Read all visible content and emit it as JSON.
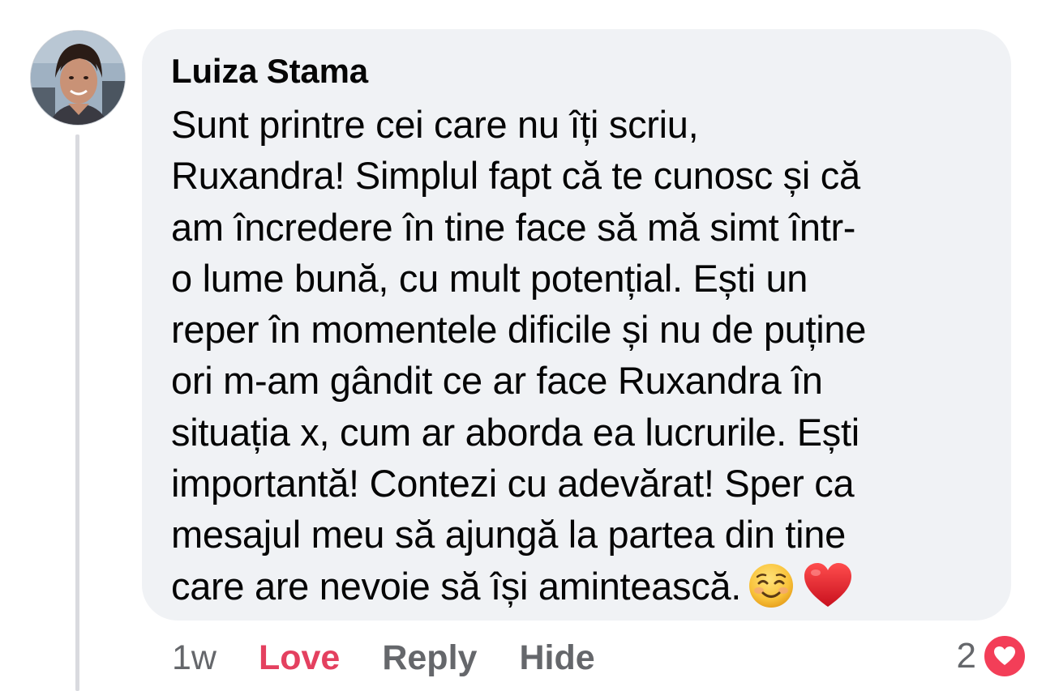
{
  "comment": {
    "author": "Luiza Stama",
    "text": "Sunt printre cei care nu îți scriu,\nRuxandra! Simplul fapt că te cunosc și că\nam încredere în tine face să mă simt într-\no lume bună, cu mult potențial. Ești un\nreper în momentele dificile și nu de puține\nori m-am gândit ce ar face Ruxandra în\nsituația x, cum ar aborda ea lucrurile. Ești\nimportantă! Contezi cu adevărat! Sper ca\nmesajul meu să ajungă la partea din tine\ncare are nevoie să își amintească.",
    "emojis": [
      "smiling-face-emoji",
      "red-heart-emoji"
    ]
  },
  "actions": {
    "time": "1w",
    "love": "Love",
    "reply": "Reply",
    "hide": "Hide"
  },
  "reactions": {
    "count": "2",
    "type": "love-reaction-icon"
  },
  "colors": {
    "bubble": "#f0f2f5",
    "love_active": "#e4405f",
    "secondary_text": "#65676b",
    "love_badge": "#f33e58"
  }
}
